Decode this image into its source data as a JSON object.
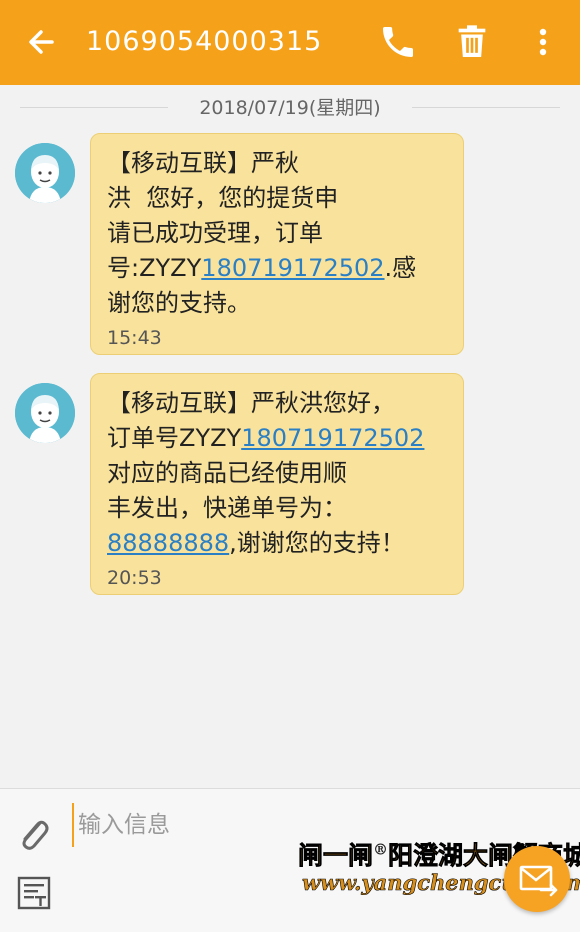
{
  "header": {
    "title": "1069054000315",
    "back_icon": "arrow-left-icon",
    "call_icon": "phone-icon",
    "delete_icon": "trash-icon",
    "more_icon": "more-vertical-icon",
    "bg_color": "#f5a11a"
  },
  "conversation": {
    "date": "2018/07/19(星期四)",
    "messages": [
      {
        "text_before": "【移动互联】严秋\n洪  您好，您的提货申\n请已成功受理，订单\n号:ZYZY",
        "link": "180719172502",
        "text_after": ".感\n谢您的支持。",
        "time": "15:43"
      },
      {
        "text_before": "【移动互联】严秋洪您好，\n订单号ZYZY",
        "link": "180719172502",
        "text_middle": "\n对应的商品已经使用顺\n丰发出，快递单号为：\n",
        "link2": "88888888",
        "text_after": ",谢谢您的支持！",
        "time": "20:53"
      }
    ]
  },
  "input": {
    "placeholder": "输入信息",
    "value": ""
  },
  "watermark": {
    "line1": "闸一闸",
    "reg": "®",
    "line1b": "阳澄湖大闸蟹商城",
    "line2": "www.yangchengcun.com"
  },
  "colors": {
    "accent": "#f5a11a",
    "bubble": "#f9e39c",
    "link": "#2b7fc4"
  }
}
